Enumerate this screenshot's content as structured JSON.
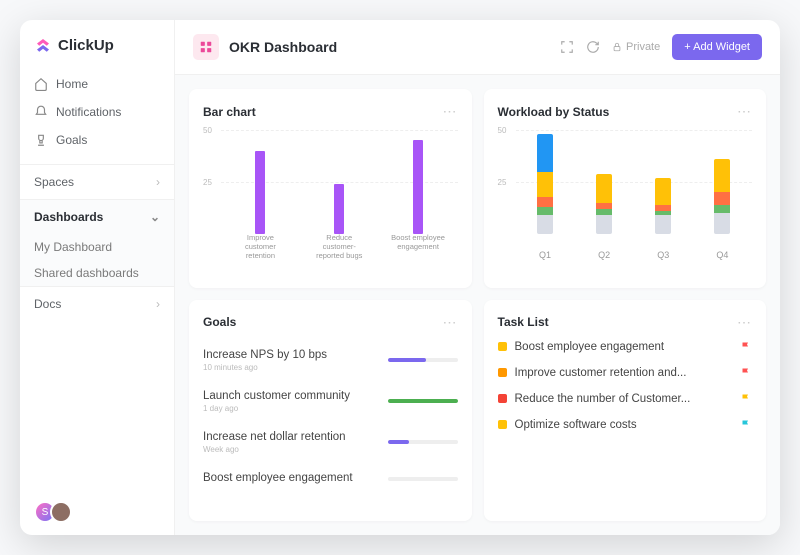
{
  "brand": "ClickUp",
  "nav": {
    "home": "Home",
    "notifications": "Notifications",
    "goals": "Goals"
  },
  "spaces_label": "Spaces",
  "dashboards": {
    "label": "Dashboards",
    "items": [
      "My Dashboard",
      "Shared dashboards"
    ]
  },
  "docs_label": "Docs",
  "header": {
    "title": "OKR Dashboard",
    "private": "Private",
    "add_widget": "+ Add Widget"
  },
  "card_bar": {
    "title": "Bar chart"
  },
  "card_workload": {
    "title": "Workload by Status"
  },
  "card_goals": {
    "title": "Goals",
    "items": [
      {
        "name": "Increase NPS by 10 bps",
        "time": "10 minutes ago",
        "pct": 55,
        "color": "#7b68ee"
      },
      {
        "name": "Launch customer community",
        "time": "1 day ago",
        "pct": 100,
        "color": "#4caf50"
      },
      {
        "name": "Increase net dollar retention",
        "time": "Week ago",
        "pct": 30,
        "color": "#7b68ee"
      },
      {
        "name": "Boost employee engagement",
        "time": "",
        "pct": 0,
        "color": "#ccc"
      }
    ]
  },
  "card_tasks": {
    "title": "Task List",
    "items": [
      {
        "name": "Boost employee engagement",
        "dot": "#ffc107",
        "flag": "#ff5252"
      },
      {
        "name": "Improve customer retention and...",
        "dot": "#ff9800",
        "flag": "#ff5252"
      },
      {
        "name": "Reduce the number of Customer...",
        "dot": "#f44336",
        "flag": "#ffc107"
      },
      {
        "name": "Optimize software costs",
        "dot": "#ffc107",
        "flag": "#26c6da"
      }
    ]
  },
  "chart_data": [
    {
      "type": "bar",
      "title": "Bar chart",
      "ylim": [
        0,
        50
      ],
      "yticks": [
        25,
        50
      ],
      "categories": [
        "Improve customer retention",
        "Reduce customer-reported bugs",
        "Boost employee engagement"
      ],
      "values": [
        40,
        24,
        45
      ],
      "color": "#a855f7"
    },
    {
      "type": "bar",
      "title": "Workload by Status",
      "ylim": [
        0,
        50
      ],
      "yticks": [
        25,
        50
      ],
      "categories": [
        "Q1",
        "Q2",
        "Q3",
        "Q4"
      ],
      "series": [
        {
          "name": "gray",
          "color": "#d8dce5",
          "values": [
            9,
            9,
            9,
            10
          ]
        },
        {
          "name": "green",
          "color": "#66bb6a",
          "values": [
            4,
            3,
            2,
            4
          ]
        },
        {
          "name": "orange",
          "color": "#ff7043",
          "values": [
            5,
            3,
            3,
            6
          ]
        },
        {
          "name": "yellow",
          "color": "#ffc107",
          "values": [
            12,
            14,
            13,
            16
          ]
        },
        {
          "name": "blue",
          "color": "#2196f3",
          "values": [
            18,
            0,
            0,
            0
          ]
        }
      ]
    }
  ]
}
